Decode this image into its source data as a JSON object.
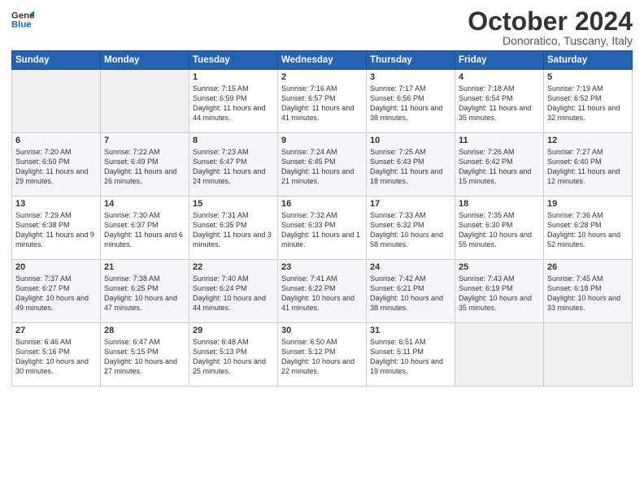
{
  "header": {
    "logo_line1": "General",
    "logo_line2": "Blue",
    "month": "October 2024",
    "location": "Donoratico, Tuscany, Italy"
  },
  "columns": [
    "Sunday",
    "Monday",
    "Tuesday",
    "Wednesday",
    "Thursday",
    "Friday",
    "Saturday"
  ],
  "weeks": [
    [
      {
        "day": "",
        "info": ""
      },
      {
        "day": "",
        "info": ""
      },
      {
        "day": "1",
        "info": "Sunrise: 7:15 AM\nSunset: 6:59 PM\nDaylight: 11 hours and 44 minutes."
      },
      {
        "day": "2",
        "info": "Sunrise: 7:16 AM\nSunset: 6:57 PM\nDaylight: 11 hours and 41 minutes."
      },
      {
        "day": "3",
        "info": "Sunrise: 7:17 AM\nSunset: 6:56 PM\nDaylight: 11 hours and 38 minutes."
      },
      {
        "day": "4",
        "info": "Sunrise: 7:18 AM\nSunset: 6:54 PM\nDaylight: 11 hours and 35 minutes."
      },
      {
        "day": "5",
        "info": "Sunrise: 7:19 AM\nSunset: 6:52 PM\nDaylight: 11 hours and 32 minutes."
      }
    ],
    [
      {
        "day": "6",
        "info": "Sunrise: 7:20 AM\nSunset: 6:50 PM\nDaylight: 11 hours and 29 minutes."
      },
      {
        "day": "7",
        "info": "Sunrise: 7:22 AM\nSunset: 6:49 PM\nDaylight: 11 hours and 26 minutes."
      },
      {
        "day": "8",
        "info": "Sunrise: 7:23 AM\nSunset: 6:47 PM\nDaylight: 11 hours and 24 minutes."
      },
      {
        "day": "9",
        "info": "Sunrise: 7:24 AM\nSunset: 6:45 PM\nDaylight: 11 hours and 21 minutes."
      },
      {
        "day": "10",
        "info": "Sunrise: 7:25 AM\nSunset: 6:43 PM\nDaylight: 11 hours and 18 minutes."
      },
      {
        "day": "11",
        "info": "Sunrise: 7:26 AM\nSunset: 6:42 PM\nDaylight: 11 hours and 15 minutes."
      },
      {
        "day": "12",
        "info": "Sunrise: 7:27 AM\nSunset: 6:40 PM\nDaylight: 11 hours and 12 minutes."
      }
    ],
    [
      {
        "day": "13",
        "info": "Sunrise: 7:29 AM\nSunset: 6:38 PM\nDaylight: 11 hours and 9 minutes."
      },
      {
        "day": "14",
        "info": "Sunrise: 7:30 AM\nSunset: 6:37 PM\nDaylight: 11 hours and 6 minutes."
      },
      {
        "day": "15",
        "info": "Sunrise: 7:31 AM\nSunset: 6:35 PM\nDaylight: 11 hours and 3 minutes."
      },
      {
        "day": "16",
        "info": "Sunrise: 7:32 AM\nSunset: 6:33 PM\nDaylight: 11 hours and 1 minute."
      },
      {
        "day": "17",
        "info": "Sunrise: 7:33 AM\nSunset: 6:32 PM\nDaylight: 10 hours and 58 minutes."
      },
      {
        "day": "18",
        "info": "Sunrise: 7:35 AM\nSunset: 6:30 PM\nDaylight: 10 hours and 55 minutes."
      },
      {
        "day": "19",
        "info": "Sunrise: 7:36 AM\nSunset: 6:28 PM\nDaylight: 10 hours and 52 minutes."
      }
    ],
    [
      {
        "day": "20",
        "info": "Sunrise: 7:37 AM\nSunset: 6:27 PM\nDaylight: 10 hours and 49 minutes."
      },
      {
        "day": "21",
        "info": "Sunrise: 7:38 AM\nSunset: 6:25 PM\nDaylight: 10 hours and 47 minutes."
      },
      {
        "day": "22",
        "info": "Sunrise: 7:40 AM\nSunset: 6:24 PM\nDaylight: 10 hours and 44 minutes."
      },
      {
        "day": "23",
        "info": "Sunrise: 7:41 AM\nSunset: 6:22 PM\nDaylight: 10 hours and 41 minutes."
      },
      {
        "day": "24",
        "info": "Sunrise: 7:42 AM\nSunset: 6:21 PM\nDaylight: 10 hours and 38 minutes."
      },
      {
        "day": "25",
        "info": "Sunrise: 7:43 AM\nSunset: 6:19 PM\nDaylight: 10 hours and 35 minutes."
      },
      {
        "day": "26",
        "info": "Sunrise: 7:45 AM\nSunset: 6:18 PM\nDaylight: 10 hours and 33 minutes."
      }
    ],
    [
      {
        "day": "27",
        "info": "Sunrise: 6:46 AM\nSunset: 5:16 PM\nDaylight: 10 hours and 30 minutes."
      },
      {
        "day": "28",
        "info": "Sunrise: 6:47 AM\nSunset: 5:15 PM\nDaylight: 10 hours and 27 minutes."
      },
      {
        "day": "29",
        "info": "Sunrise: 6:48 AM\nSunset: 5:13 PM\nDaylight: 10 hours and 25 minutes."
      },
      {
        "day": "30",
        "info": "Sunrise: 6:50 AM\nSunset: 5:12 PM\nDaylight: 10 hours and 22 minutes."
      },
      {
        "day": "31",
        "info": "Sunrise: 6:51 AM\nSunset: 5:11 PM\nDaylight: 10 hours and 19 minutes."
      },
      {
        "day": "",
        "info": ""
      },
      {
        "day": "",
        "info": ""
      }
    ]
  ]
}
